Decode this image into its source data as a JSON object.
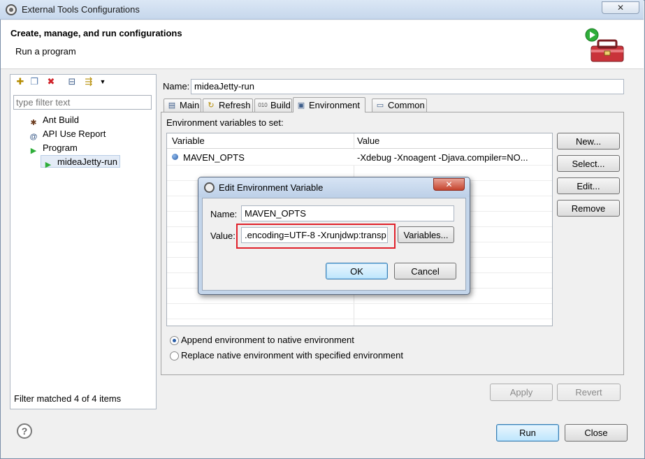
{
  "window": {
    "title": "External Tools Configurations",
    "close_glyph": "✕"
  },
  "header": {
    "title": "Create, manage, and run configurations",
    "subtitle": "Run a program"
  },
  "left": {
    "filter_placeholder": "type filter text",
    "tree": [
      {
        "label": "Ant Build",
        "icon": "ant-build-icon"
      },
      {
        "label": "API Use Report",
        "icon": "api-use-report-icon"
      },
      {
        "label": "Program",
        "icon": "program-icon"
      },
      {
        "label": "mideaJetty-run",
        "icon": "program-config-icon"
      }
    ],
    "status": "Filter matched 4 of 4 items"
  },
  "right": {
    "name_label": "Name:",
    "name_value": "mideaJetty-run",
    "tabs": [
      {
        "label": "Main",
        "icon": "main-tab-icon"
      },
      {
        "label": "Refresh",
        "icon": "refresh-tab-icon"
      },
      {
        "label": "Build",
        "icon": "build-tab-icon"
      },
      {
        "label": "Environment",
        "icon": "environment-tab-icon",
        "active": true
      },
      {
        "label": "Common",
        "icon": "common-tab-icon"
      }
    ],
    "env_label": "Environment variables to set:",
    "table": {
      "headers": [
        "Variable",
        "Value"
      ],
      "rows": [
        {
          "variable": "MAVEN_OPTS",
          "value": "-Xdebug -Xnoagent -Djava.compiler=NO..."
        }
      ]
    },
    "side_buttons": [
      "New...",
      "Select...",
      "Edit...",
      "Remove"
    ],
    "radios": [
      {
        "label": "Append environment to native environment",
        "checked": true
      },
      {
        "label": "Replace native environment with specified environment",
        "checked": false
      }
    ],
    "apply_label": "Apply",
    "revert_label": "Revert"
  },
  "footer": {
    "help_glyph": "?",
    "run_label": "Run",
    "close_label": "Close"
  },
  "dialog": {
    "title": "Edit Environment Variable",
    "close_glyph": "✕",
    "name_label": "Name:",
    "name_value": "MAVEN_OPTS",
    "value_label": "Value:",
    "value_text": ".encoding=UTF-8 -Xrunjdwp:transp",
    "variables_label": "Variables...",
    "ok_label": "OK",
    "cancel_label": "Cancel"
  },
  "colors": {
    "highlight_box": "#e0202a",
    "selection": "#e4ecf7",
    "title_bar": "#c6d7ec"
  }
}
